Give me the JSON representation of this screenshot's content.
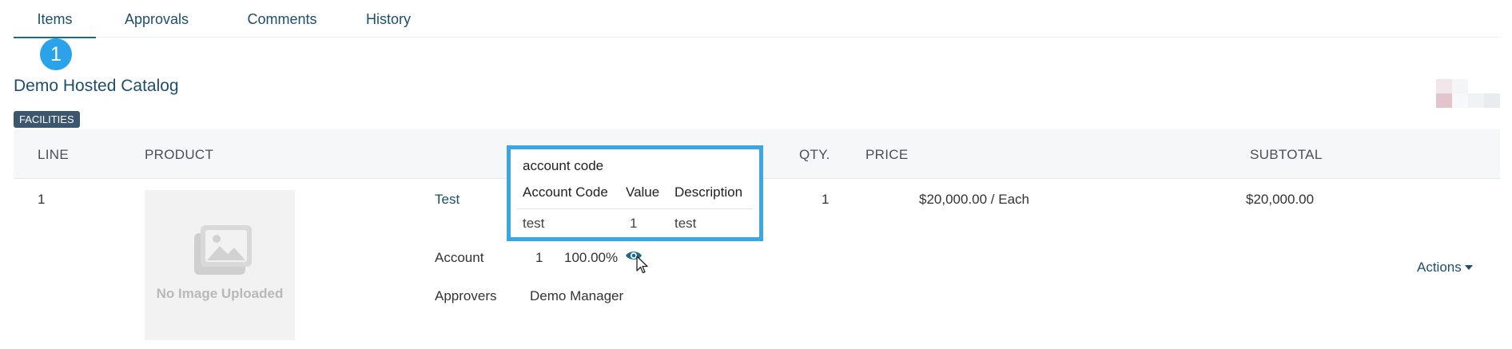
{
  "tabs": [
    {
      "label": "Items",
      "active": true
    },
    {
      "label": "Approvals"
    },
    {
      "label": "Comments"
    },
    {
      "label": "History"
    }
  ],
  "step_badge": "1",
  "catalog": {
    "title": "Demo Hosted Catalog",
    "department_badge": "FACILITIES"
  },
  "table": {
    "headers": {
      "line": "LINE",
      "product": "PRODUCT",
      "qty": "QTY.",
      "price": "PRICE",
      "subtotal": "SUBTOTAL"
    },
    "row": {
      "line": "1",
      "product_name": "Test",
      "image_placeholder": "No Image Uploaded",
      "qty": "1",
      "price": "$20,000.00 / Each",
      "subtotal": "$20,000.00",
      "account_label": "Account",
      "account_count": "1",
      "account_percent": "100.00%",
      "approvers_label": "Approvers",
      "approvers_value": "Demo Manager",
      "actions_label": "Actions"
    }
  },
  "popover": {
    "title": "account code",
    "columns": [
      "Account Code",
      "Value",
      "Description"
    ],
    "rows": [
      [
        "test",
        "1",
        "test"
      ]
    ]
  },
  "colors": {
    "link": "#1d4e6e",
    "accent_blue": "#3aa6e8",
    "badge": "#3d5670",
    "header_bg": "#f6f7f8"
  }
}
